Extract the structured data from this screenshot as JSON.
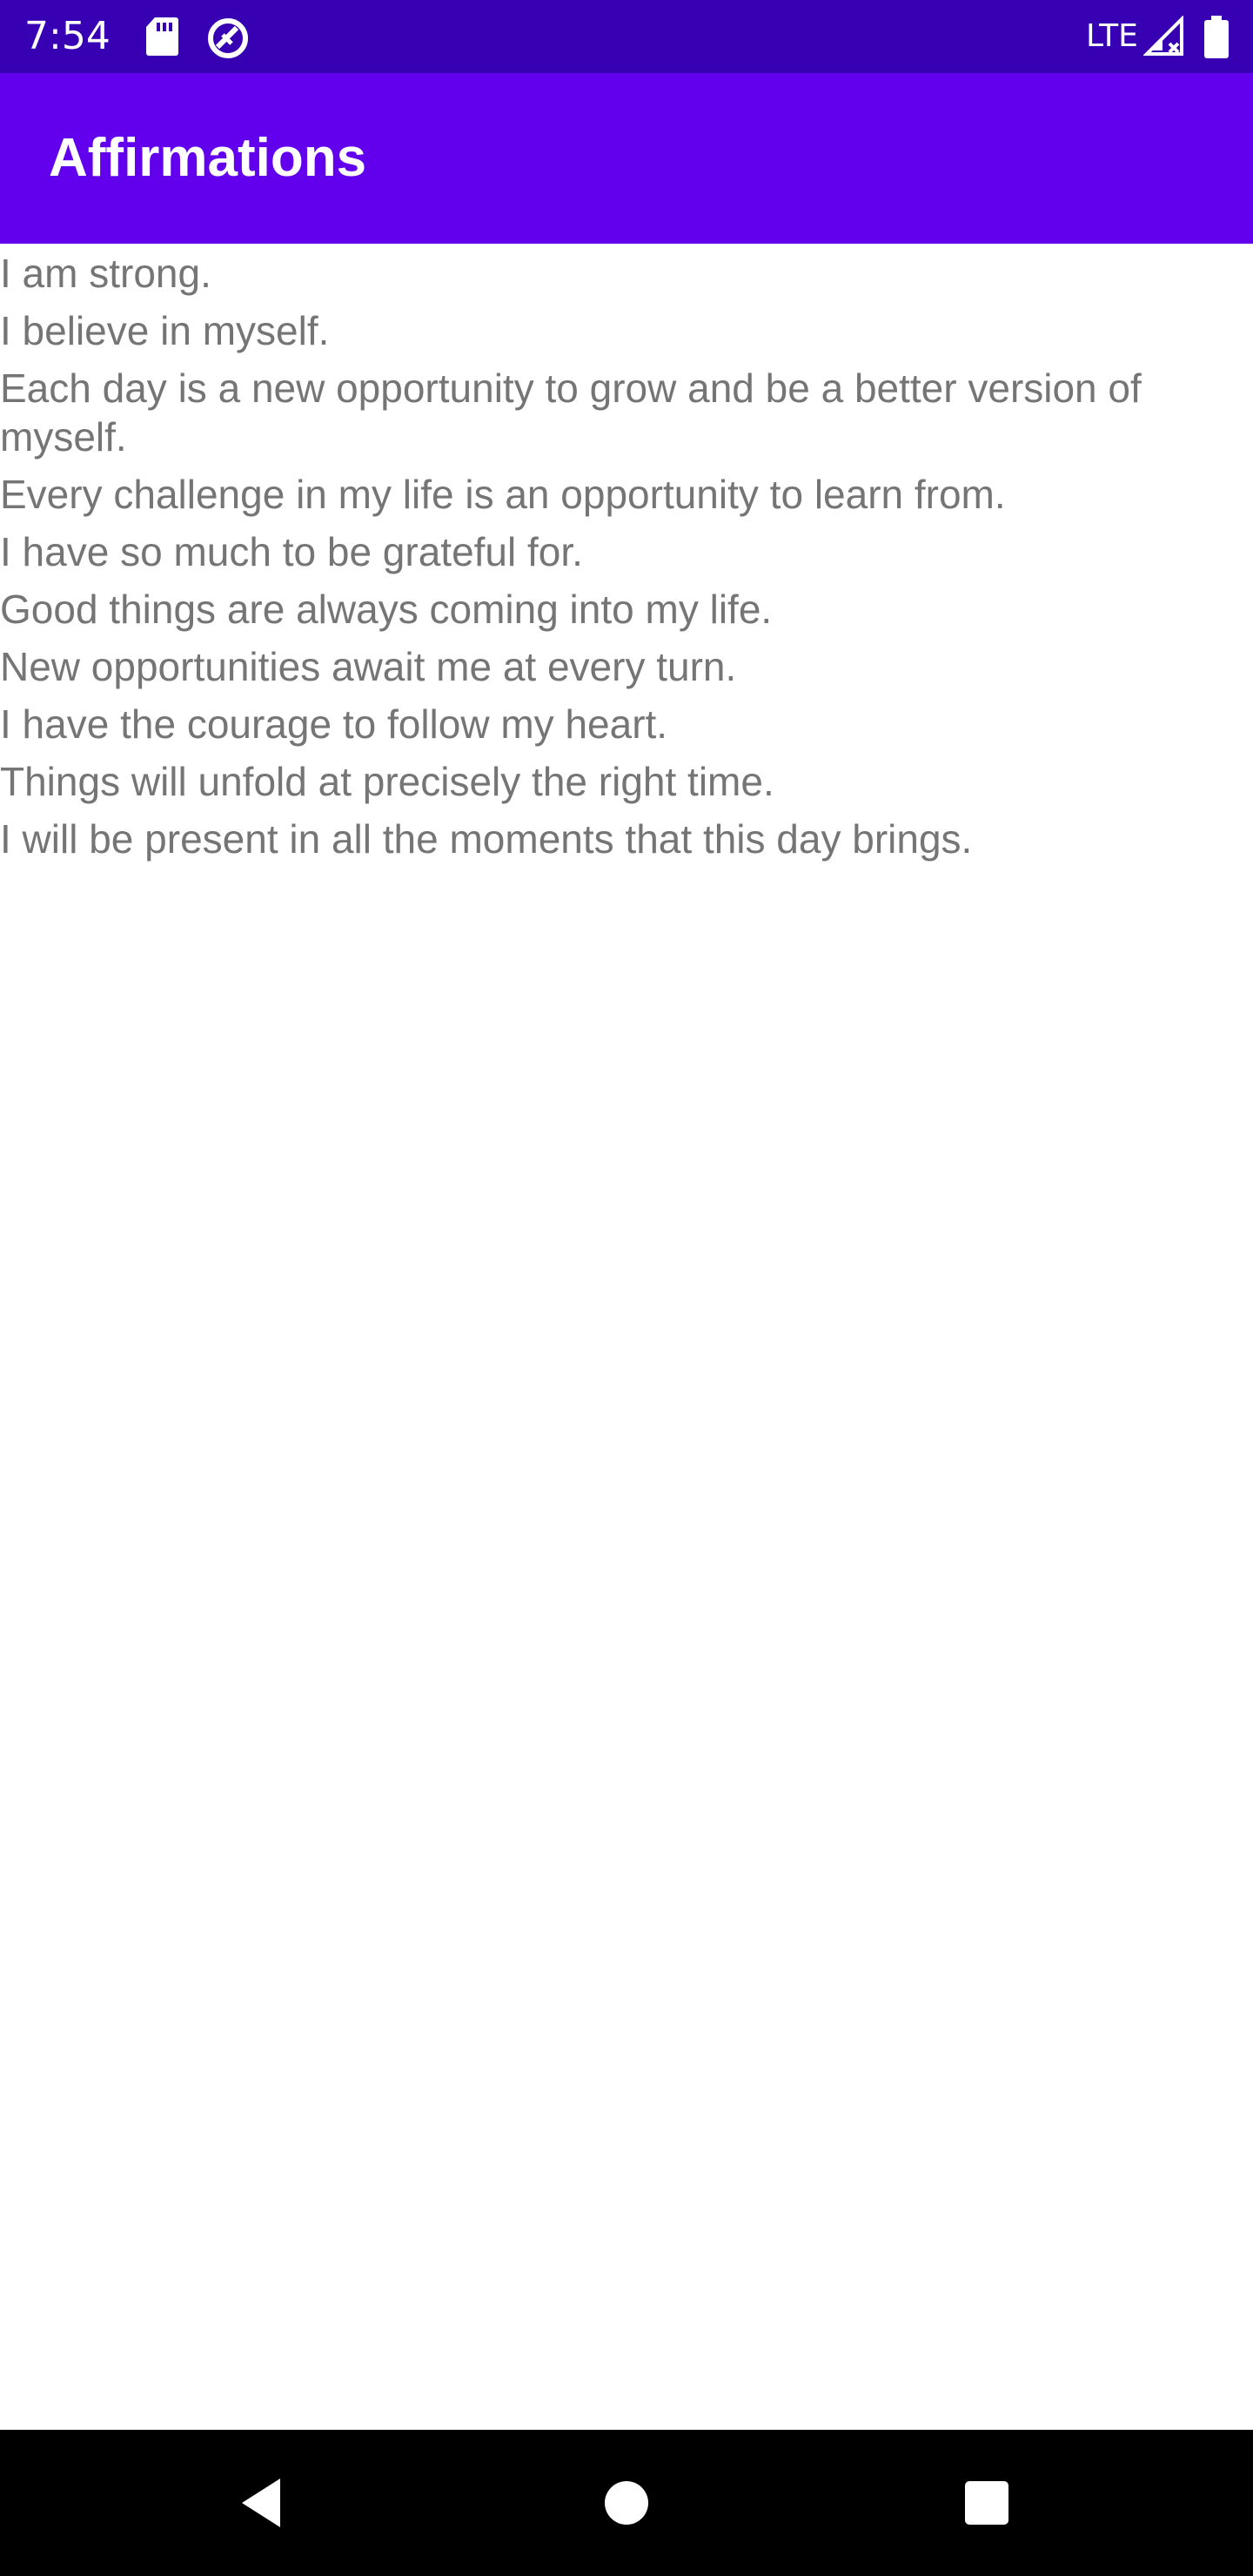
{
  "status_bar": {
    "time": "7:54",
    "network": "LTE",
    "icons": [
      "sd-card-icon",
      "no-disturb-icon",
      "signal-icon",
      "battery-icon"
    ],
    "background": "#3700B3"
  },
  "app_bar": {
    "title": "Affirmations",
    "background": "#6200EE",
    "title_color": "#FFFFFF"
  },
  "affirmations": [
    "I am strong.",
    "I believe in myself.",
    "Each day is a new opportunity to grow and be a better version of myself.",
    "Every challenge in my life is an opportunity to learn from.",
    "I have so much to be grateful for.",
    "Good things are always coming into my life.",
    "New opportunities await me at every turn.",
    "I have the courage to follow my heart.",
    "Things will unfold at precisely the right time.",
    "I will be present in all the moments that this day brings."
  ],
  "text_color": "#757575",
  "nav_bar": {
    "icons": [
      "back-icon",
      "home-icon",
      "recents-icon"
    ],
    "background": "#000000"
  }
}
